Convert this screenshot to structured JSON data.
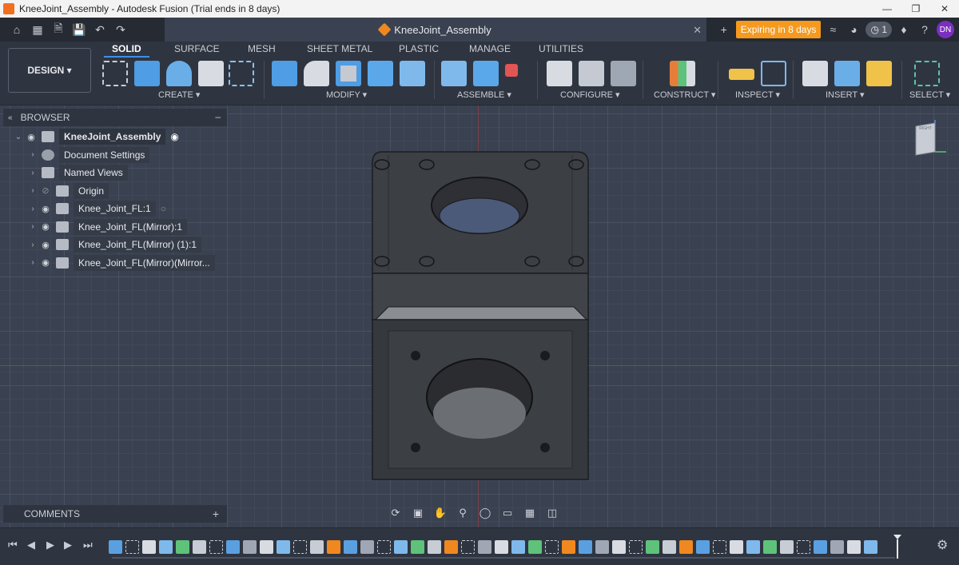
{
  "titlebar": {
    "title": "KneeJoint_Assembly - Autodesk Fusion (Trial ends in 8 days)"
  },
  "tabbar": {
    "doc_tab_label": "KneeJoint_Assembly",
    "expire_label": "Expiring in 8 days",
    "job_count": "1",
    "avatar_initials": "DN"
  },
  "ribbon": {
    "workspace_label": "DESIGN ▾",
    "tabs": [
      "SOLID",
      "SURFACE",
      "MESH",
      "SHEET METAL",
      "PLASTIC",
      "MANAGE",
      "UTILITIES"
    ],
    "groups": [
      "CREATE ▾",
      "MODIFY ▾",
      "ASSEMBLE ▾",
      "CONFIGURE ▾",
      "CONSTRUCT ▾",
      "INSPECT ▾",
      "INSERT ▾",
      "SELECT ▾"
    ]
  },
  "browser": {
    "header": "BROWSER",
    "items": [
      {
        "label": "KneeJoint_Assembly"
      },
      {
        "label": "Document Settings"
      },
      {
        "label": "Named Views"
      },
      {
        "label": "Origin"
      },
      {
        "label": "Knee_Joint_FL:1"
      },
      {
        "label": "Knee_Joint_FL(Mirror):1"
      },
      {
        "label": "Knee_Joint_FL(Mirror) (1):1"
      },
      {
        "label": "Knee_Joint_FL(Mirror)(Mirror..."
      }
    ]
  },
  "comments": {
    "label": "COMMENTS"
  },
  "viewcube": {
    "face_label": "RIGHT"
  },
  "colors": {
    "accent": "#3d8fe6",
    "expire": "#f59a1e",
    "brand": "#f26f21",
    "model": "#3c3f44"
  }
}
